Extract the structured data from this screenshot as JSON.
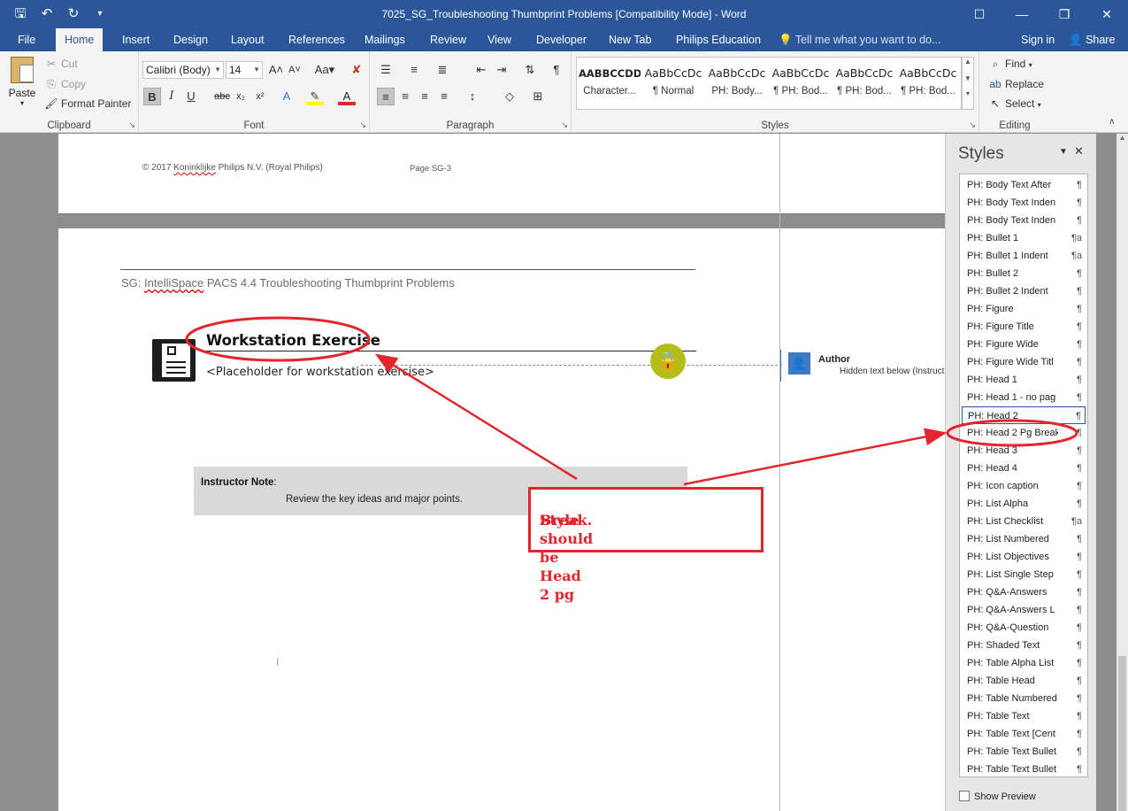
{
  "window": {
    "title": "7025_SG_Troubleshooting Thumbprint Problems [Compatibility Mode] - Word",
    "qat_icons": [
      "save-icon",
      "undo-icon",
      "redo-icon",
      "customize-icon"
    ]
  },
  "tabs": [
    "File",
    "Home",
    "Insert",
    "Design",
    "Layout",
    "References",
    "Mailings",
    "Review",
    "View",
    "Developer",
    "New Tab",
    "Philips Education"
  ],
  "active_tab": "Home",
  "tell_me": "Tell me what you want to do...",
  "sign_in": "Sign in",
  "share": "Share",
  "clipboard": {
    "paste": "Paste",
    "cut": "Cut",
    "copy": "Copy",
    "format_painter": "Format Painter",
    "label": "Clipboard"
  },
  "font": {
    "name": "Calibri (Body)",
    "size": "14",
    "label": "Font"
  },
  "paragraph": {
    "label": "Paragraph"
  },
  "styles_gallery": {
    "label": "Styles",
    "tiles": [
      {
        "preview": "AABBCCDD",
        "name": "Character..."
      },
      {
        "preview": "AaBbCcDc",
        "name": "¶ Normal"
      },
      {
        "preview": "AaBbCcDc",
        "name": "PH: Body..."
      },
      {
        "preview": "AaBbCcDc",
        "name": "¶ PH: Bod..."
      },
      {
        "preview": "AaBbCcDc",
        "name": "¶ PH: Bod..."
      },
      {
        "preview": "AaBbCcDc",
        "name": "¶ PH: Bod..."
      }
    ]
  },
  "editing": {
    "find": "Find",
    "replace": "Replace",
    "select": "Select",
    "label": "Editing"
  },
  "document": {
    "footer_copyright_prefix": "© 2017 ",
    "footer_copyright_wavy": "Koninklijke",
    "footer_copyright_suffix": " Philips N.V. (Royal Philips)",
    "footer_page": "Page SG-3",
    "header_prefix": "SG: ",
    "header_wavy": "IntelliSpace",
    "header_suffix": " PACS 4.4  Troubleshooting Thumbprint Problems",
    "heading": "Workstation Exercise",
    "placeholder": "<Placeholder for workstation exercise>",
    "instructor_note_label": "Instructor Note",
    "instructor_note_colon": ":",
    "instructor_note_text": "Review the key ideas and major points."
  },
  "comment": {
    "author": "Author",
    "text": "Hidden text below (Instruct"
  },
  "callout": {
    "line1": "Style should be Head 2 pg",
    "line2": "Break."
  },
  "styles_pane": {
    "title": "Styles",
    "show_preview": "Show Preview",
    "selected": "PH: Head 2",
    "items": [
      {
        "name": "PH: Body Text After",
        "mark": "¶"
      },
      {
        "name": "PH: Body Text Inden",
        "mark": "¶"
      },
      {
        "name": "PH: Body Text Inden",
        "mark": "¶"
      },
      {
        "name": "PH: Bullet 1",
        "mark": "¶a"
      },
      {
        "name": "PH: Bullet 1 Indent",
        "mark": "¶a"
      },
      {
        "name": "PH: Bullet 2",
        "mark": "¶"
      },
      {
        "name": "PH: Bullet 2 Indent",
        "mark": "¶"
      },
      {
        "name": "PH: Figure",
        "mark": "¶"
      },
      {
        "name": "PH: Figure Title",
        "mark": "¶"
      },
      {
        "name": "PH: Figure Wide",
        "mark": "¶"
      },
      {
        "name": "PH: Figure Wide Titl",
        "mark": "¶"
      },
      {
        "name": "PH: Head 1",
        "mark": "¶"
      },
      {
        "name": "PH: Head 1 - no pag",
        "mark": "¶"
      },
      {
        "name": "PH: Head 2",
        "mark": "¶"
      },
      {
        "name": "PH: Head 2 Pg Break",
        "mark": "¶"
      },
      {
        "name": "PH: Head 3",
        "mark": "¶"
      },
      {
        "name": "PH: Head 4",
        "mark": "¶"
      },
      {
        "name": "PH: Icon caption",
        "mark": "¶"
      },
      {
        "name": "PH: List Alpha",
        "mark": "¶"
      },
      {
        "name": "PH: List Checklist",
        "mark": "¶a"
      },
      {
        "name": "PH: List Numbered",
        "mark": "¶"
      },
      {
        "name": "PH: List Objectives",
        "mark": "¶"
      },
      {
        "name": "PH: List Single Step",
        "mark": "¶"
      },
      {
        "name": "PH: Q&A-Answers",
        "mark": "¶"
      },
      {
        "name": "PH: Q&A-Answers L",
        "mark": "¶"
      },
      {
        "name": "PH: Q&A-Question",
        "mark": "¶"
      },
      {
        "name": "PH: Shaded Text",
        "mark": "¶"
      },
      {
        "name": "PH: Table Alpha List",
        "mark": "¶"
      },
      {
        "name": "PH: Table Head",
        "mark": "¶"
      },
      {
        "name": "PH: Table Numbered",
        "mark": "¶"
      },
      {
        "name": "PH: Table Text",
        "mark": "¶"
      },
      {
        "name": "PH: Table Text [Cent",
        "mark": "¶"
      },
      {
        "name": "PH: Table Text Bullet",
        "mark": "¶"
      },
      {
        "name": "PH: Table Text Bullet",
        "mark": "¶"
      }
    ]
  },
  "colors": {
    "word_blue": "#2b579a",
    "annotation_red": "#e3262b",
    "lock_green": "#b5be18"
  }
}
